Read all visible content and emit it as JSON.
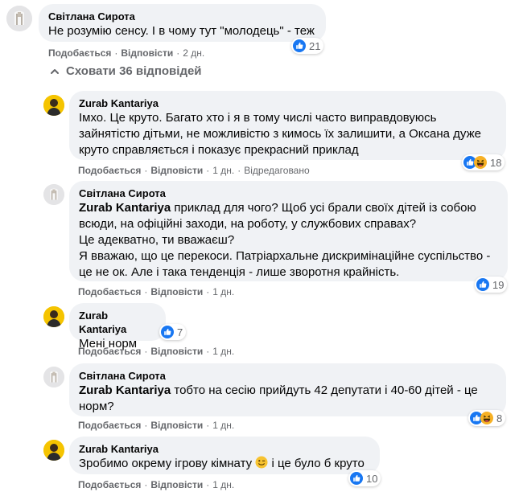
{
  "comments": [
    {
      "author": "Світлана Сирота",
      "lines": [
        "Не розумію сенсу. І в чому тут \"молодець\" - теж"
      ],
      "like_label": "Подобається",
      "reply_label": "Відповісти",
      "time": "2 дн.",
      "reactions": [
        "like"
      ],
      "reaction_count": "21"
    },
    {
      "author": "Zurab Kantariya",
      "lines": [
        "Імхо. Це круто. Багато хто і я в тому числі часто виправдовуюсь",
        "зайнятістю дітьми, не можливістю з кимось їх залишити, а Оксана дуже",
        "круто справляється і показує прекрасний приклад"
      ],
      "like_label": "Подобається",
      "reply_label": "Відповісти",
      "time": "1 дн.",
      "edited": "Відредаговано",
      "reactions": [
        "like",
        "haha"
      ],
      "reaction_count": "18"
    },
    {
      "author": "Світлана Сирота",
      "mention": "Zurab Kantariya",
      "first_line_rest": " приклад для чого? Щоб усі брали своїх дітей із собою",
      "lines": [
        "всюди, на офіційні заходи, на роботу, у службових справах?",
        "Це адекватно, ти вважаєш?",
        "Я вважаю, що це перекоси. Патріархальне дискримінаційне суспільство -",
        "це не ок. Але і така тенденція - лише зворотня крайність."
      ],
      "like_label": "Подобається",
      "reply_label": "Відповісти",
      "time": "1 дн.",
      "reactions": [
        "like"
      ],
      "reaction_count": "19"
    },
    {
      "author": "Zurab Kantariya",
      "lines": [
        "Мені норм"
      ],
      "like_label": "Подобається",
      "reply_label": "Відповісти",
      "time": "1 дн.",
      "reactions": [
        "like"
      ],
      "reaction_count": "7"
    },
    {
      "author": "Світлана Сирота",
      "mention": "Zurab Kantariya",
      "first_line_rest": " тобто на сесію прийдуть 42 депутати і 40-60 дітей - це",
      "lines": [
        "норм?"
      ],
      "like_label": "Подобається",
      "reply_label": "Відповісти",
      "time": "1 дн.",
      "reactions": [
        "like",
        "haha"
      ],
      "reaction_count": "8"
    },
    {
      "author": "Zurab Kantariya",
      "line_before_emoji": "Зробимо окрему ігрову кімнату ",
      "emoji": "winking-face",
      "line_after_emoji": " і це було б круто",
      "like_label": "Подобається",
      "reply_label": "Відповісти",
      "time": "1 дн.",
      "reactions": [
        "like"
      ],
      "reaction_count": "10"
    }
  ],
  "hide_replies_label": "Сховати 36 відповідей",
  "colors": {
    "like_blue": "#1877f2",
    "haha_yellow": "#f7b125",
    "bubble_bg": "#f0f2f5",
    "secondary_text": "#65676b"
  }
}
